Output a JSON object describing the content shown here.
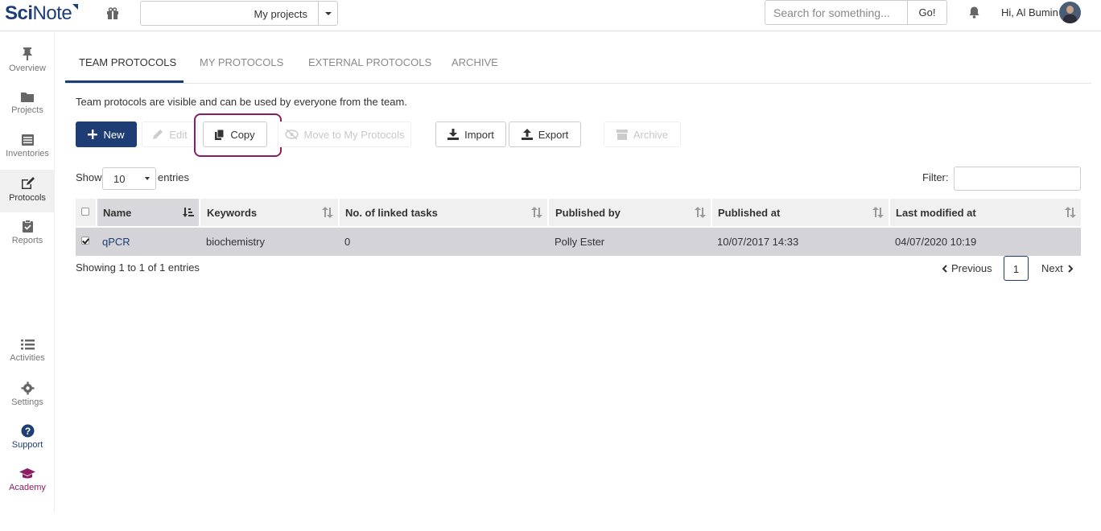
{
  "header": {
    "logo_text_sci": "Sci",
    "logo_text_note": "Note",
    "project_select": "My projects",
    "search_placeholder": "Search for something...",
    "go_label": "Go!",
    "greeting": "Hi, Al Bumin"
  },
  "sidebar": {
    "items": [
      {
        "label": "Overview",
        "icon": "pin-icon"
      },
      {
        "label": "Projects",
        "icon": "folder-icon"
      },
      {
        "label": "Inventories",
        "icon": "list-box-icon"
      },
      {
        "label": "Protocols",
        "icon": "edit-icon"
      },
      {
        "label": "Reports",
        "icon": "clipboard-icon"
      },
      {
        "label": "Activities",
        "icon": "list-icon"
      },
      {
        "label": "Settings",
        "icon": "gear-icon"
      },
      {
        "label": "Support",
        "icon": "question-icon"
      },
      {
        "label": "Academy",
        "icon": "graduation-cap-icon"
      }
    ]
  },
  "tabs": [
    "TEAM PROTOCOLS",
    "MY PROTOCOLS",
    "EXTERNAL PROTOCOLS",
    "ARCHIVE"
  ],
  "description": "Team protocols are visible and can be used by everyone from the team.",
  "toolbar": {
    "new": "New",
    "edit": "Edit",
    "copy": "Copy",
    "move": "Move to My Protocols",
    "import": "Import",
    "export": "Export",
    "archive": "Archive"
  },
  "length": {
    "show": "Show",
    "value": "10",
    "entries": "entries"
  },
  "filter_label": "Filter:",
  "table": {
    "headers": [
      "Name",
      "Keywords",
      "No. of linked tasks",
      "Published by",
      "Published at",
      "Last modified at"
    ],
    "rows": [
      {
        "name": "qPCR",
        "keywords": "biochemistry",
        "linked": "0",
        "published_by": "Polly Ester",
        "published_at": "10/07/2017 14:33",
        "modified": "04/07/2020 10:19",
        "checked": true
      }
    ]
  },
  "info": "Showing 1 to 1 of 1 entries",
  "pagination": {
    "previous": "Previous",
    "current": "1",
    "next": "Next"
  },
  "colors": {
    "brand": "#1d3d74",
    "academy": "#8b1d63",
    "highlight": "#8b1d63"
  }
}
